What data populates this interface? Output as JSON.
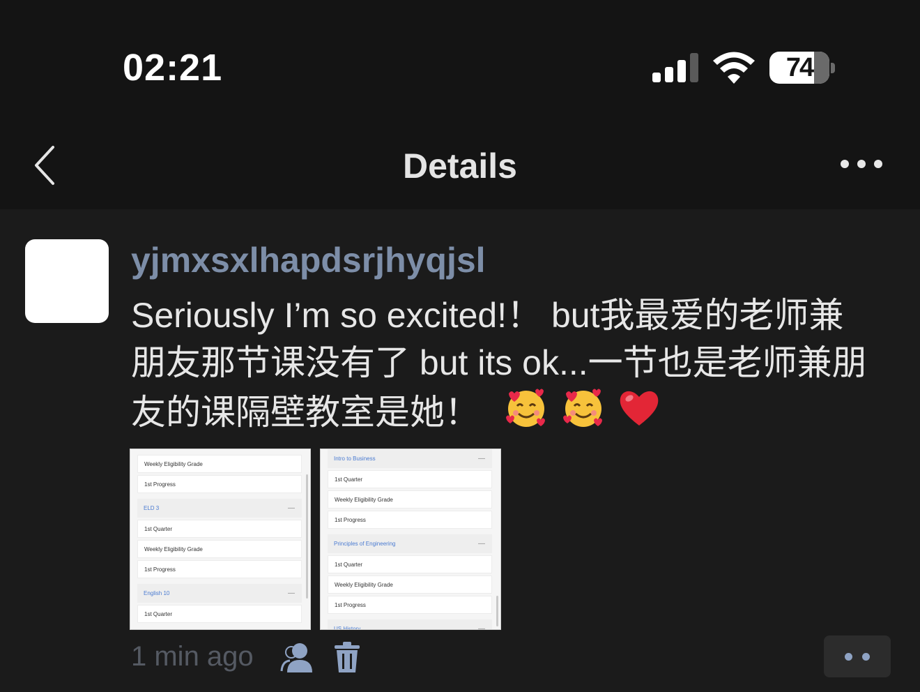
{
  "status_bar": {
    "time": "02:21",
    "battery": {
      "value": "74",
      "level": 0.74
    },
    "icons": [
      "cellular-signal-icon",
      "wifi-icon",
      "battery-icon"
    ]
  },
  "nav": {
    "title": "Details",
    "back_icon": "chevron-left-icon",
    "more_icon": "ellipsis-icon"
  },
  "post": {
    "username": "yjmxsxlhapdsrjhyqjsl",
    "text_line1": "Seriously I’m so excited!！ but我最爱的老师兼",
    "text_line2": "朋友那节课没有了 but its ok...一节也是老师兼朋",
    "text_line3": "友的课隔壁教室是她！",
    "emoji": [
      "smiling-face-with-hearts",
      "smiling-face-with-hearts",
      "red-heart"
    ],
    "images": [
      {
        "rows": [
          {
            "kind": "row",
            "text": "Weekly Eligibility Grade"
          },
          {
            "kind": "row",
            "text": "1st Progress"
          },
          {
            "kind": "head",
            "text": "ELD 3"
          },
          {
            "kind": "row",
            "text": "1st Quarter"
          },
          {
            "kind": "row",
            "text": "Weekly Eligibility Grade"
          },
          {
            "kind": "row",
            "text": "1st Progress"
          },
          {
            "kind": "head",
            "text": "English 10"
          },
          {
            "kind": "row",
            "text": "1st Quarter"
          }
        ]
      },
      {
        "rows": [
          {
            "kind": "head",
            "text": "Intro to Business"
          },
          {
            "kind": "row",
            "text": "1st Quarter"
          },
          {
            "kind": "row",
            "text": "Weekly Eligibility Grade"
          },
          {
            "kind": "row",
            "text": "1st Progress"
          },
          {
            "kind": "head",
            "text": "Principles of Engineering"
          },
          {
            "kind": "row",
            "text": "1st Quarter"
          },
          {
            "kind": "row",
            "text": "Weekly Eligibility Grade"
          },
          {
            "kind": "row",
            "text": "1st Progress"
          },
          {
            "kind": "head",
            "text": "US History"
          }
        ]
      }
    ],
    "timestamp": "1 min ago",
    "footer_icons": [
      "person-icon",
      "trash-icon",
      "comment-icon"
    ]
  },
  "colors": {
    "background": "#1b1b1b",
    "bars": "#141414",
    "username": "#7d8ea8",
    "body_text": "#e7e7e7",
    "timestamp": "#555a63",
    "icon_blue": "#8fa3c4",
    "link_blue": "#4a7bd1"
  }
}
